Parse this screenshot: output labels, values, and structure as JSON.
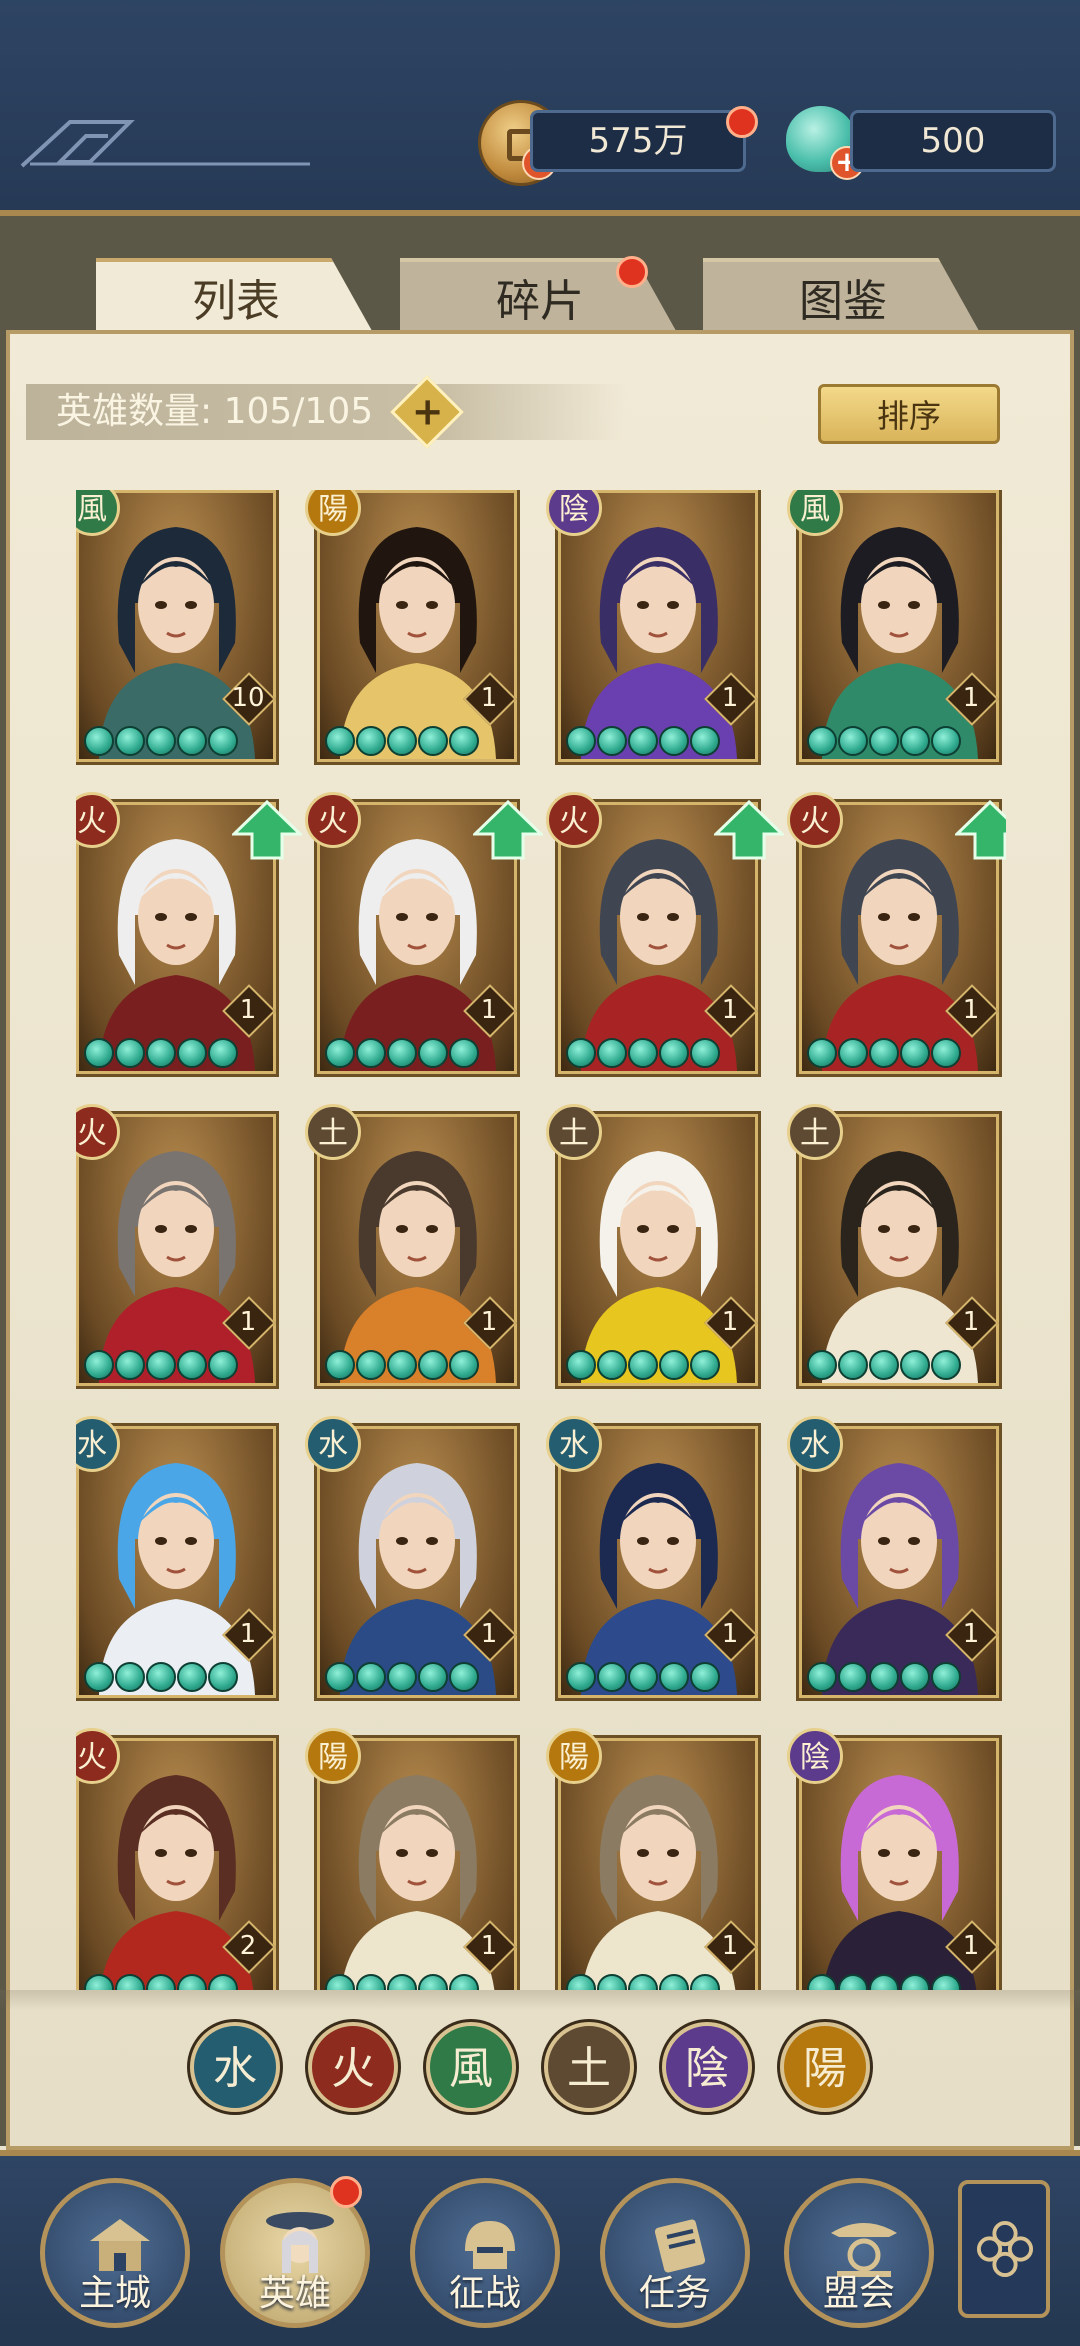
{
  "resources": {
    "coins": "575万",
    "gems": "500"
  },
  "tabs": [
    {
      "label": "列表",
      "active": true
    },
    {
      "label": "碎片",
      "active": false
    },
    {
      "label": "图鉴",
      "active": false
    }
  ],
  "hero_count_label": "英雄数量: 105/105",
  "sort_label": "排序",
  "add_symbol": "+",
  "colors": {
    "topbar": "#2e4463",
    "accent_gold": "#d5b46b",
    "star_jade": "#2ea98e",
    "upgrade_green": "#34b56a"
  },
  "heroes": [
    {
      "element": "wind",
      "glyph": "風",
      "level": "10",
      "stars": 5,
      "upgrade": false,
      "hair": "#1d2a3a",
      "cloth": "#3a6b66"
    },
    {
      "element": "yang",
      "glyph": "陽",
      "level": "1",
      "stars": 5,
      "upgrade": false,
      "hair": "#20160f",
      "cloth": "#e6c46a"
    },
    {
      "element": "yin",
      "glyph": "陰",
      "level": "1",
      "stars": 5,
      "upgrade": false,
      "hair": "#3a2e66",
      "cloth": "#6a3fb0"
    },
    {
      "element": "wind",
      "glyph": "風",
      "level": "1",
      "stars": 5,
      "upgrade": false,
      "hair": "#1c1c22",
      "cloth": "#2f8a6a"
    },
    {
      "element": "fire",
      "glyph": "火",
      "level": "1",
      "stars": 5,
      "upgrade": true,
      "hair": "#eeeeee",
      "cloth": "#7a1f1f"
    },
    {
      "element": "fire",
      "glyph": "火",
      "level": "1",
      "stars": 5,
      "upgrade": true,
      "hair": "#eeeeee",
      "cloth": "#7a1f1f"
    },
    {
      "element": "fire",
      "glyph": "火",
      "level": "1",
      "stars": 5,
      "upgrade": true,
      "hair": "#3f4652",
      "cloth": "#a82424"
    },
    {
      "element": "fire",
      "glyph": "火",
      "level": "1",
      "stars": 5,
      "upgrade": true,
      "hair": "#3f4652",
      "cloth": "#a82424"
    },
    {
      "element": "fire",
      "glyph": "火",
      "level": "1",
      "stars": 5,
      "upgrade": false,
      "hair": "#7a7470",
      "cloth": "#b0202a"
    },
    {
      "element": "earth",
      "glyph": "土",
      "level": "1",
      "stars": 5,
      "upgrade": false,
      "hair": "#4a3a2e",
      "cloth": "#d9802a"
    },
    {
      "element": "earth",
      "glyph": "土",
      "level": "1",
      "stars": 5,
      "upgrade": false,
      "hair": "#f4f2ea",
      "cloth": "#e8c620"
    },
    {
      "element": "earth",
      "glyph": "土",
      "level": "1",
      "stars": 5,
      "upgrade": false,
      "hair": "#2a241c",
      "cloth": "#efe6d2"
    },
    {
      "element": "water",
      "glyph": "水",
      "level": "1",
      "stars": 5,
      "upgrade": false,
      "hair": "#4aa6e6",
      "cloth": "#ebeff3"
    },
    {
      "element": "water",
      "glyph": "水",
      "level": "1",
      "stars": 5,
      "upgrade": false,
      "hair": "#cfd2dc",
      "cloth": "#2a4b86"
    },
    {
      "element": "water",
      "glyph": "水",
      "level": "1",
      "stars": 5,
      "upgrade": false,
      "hair": "#1c2a52",
      "cloth": "#2c4a8c"
    },
    {
      "element": "water",
      "glyph": "水",
      "level": "1",
      "stars": 5,
      "upgrade": false,
      "hair": "#6b4aa6",
      "cloth": "#3a2a5a"
    },
    {
      "element": "fire",
      "glyph": "火",
      "level": "2",
      "stars": 5,
      "upgrade": false,
      "hair": "#5a2e22",
      "cloth": "#b2281f"
    },
    {
      "element": "yang",
      "glyph": "陽",
      "level": "1",
      "stars": 5,
      "upgrade": false,
      "hair": "#8a7b62",
      "cloth": "#eee6cc"
    },
    {
      "element": "yang",
      "glyph": "陽",
      "level": "1",
      "stars": 5,
      "upgrade": false,
      "hair": "#8a7b62",
      "cloth": "#eee6cc"
    },
    {
      "element": "yin",
      "glyph": "陰",
      "level": "1",
      "stars": 5,
      "upgrade": false,
      "hair": "#c86ad6",
      "cloth": "#2a2038"
    }
  ],
  "filters": [
    {
      "element": "water",
      "glyph": "水"
    },
    {
      "element": "fire",
      "glyph": "火"
    },
    {
      "element": "wind",
      "glyph": "風"
    },
    {
      "element": "earth",
      "glyph": "土"
    },
    {
      "element": "yin",
      "glyph": "陰"
    },
    {
      "element": "yang",
      "glyph": "陽"
    }
  ],
  "nav": [
    {
      "label": "主城",
      "icon": "castle-icon",
      "active": false
    },
    {
      "label": "英雄",
      "icon": "hero-portrait-icon",
      "active": true
    },
    {
      "label": "征战",
      "icon": "helmet-icon",
      "active": false
    },
    {
      "label": "任务",
      "icon": "scroll-icon",
      "active": false
    },
    {
      "label": "盟会",
      "icon": "pavilion-icon",
      "active": false
    }
  ]
}
